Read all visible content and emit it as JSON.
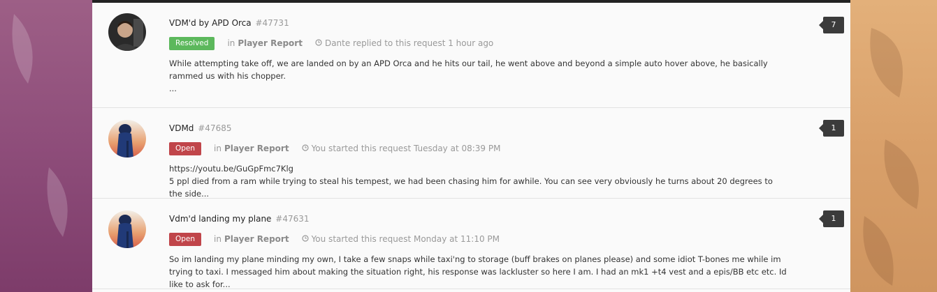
{
  "requests": [
    {
      "title": "VDM'd by APD Orca",
      "id": "#47731",
      "status": "Resolved",
      "in_label": "in",
      "category": "Player Report",
      "activity": "Dante replied to this request 1 hour ago",
      "body": "While attempting take off, we are landed on by an APD Orca and he hits our tail, he went above and beyond a simple auto hover above, he basically rammed us with his chopper.",
      "ellipsis": "...",
      "reply_count": "7"
    },
    {
      "title": "VDMd",
      "id": "#47685",
      "status": "Open",
      "in_label": "in",
      "category": "Player Report",
      "activity": "You started this request Tuesday at 08:39 PM",
      "body_line1": "https://youtu.be/GuGpFmc7Klg",
      "body_line2": "5 ppl died from a ram while trying to steal his tempest, we had been chasing him for awhile. You can see very obviously he turns about 20 degrees to the side...",
      "reply_count": "1"
    },
    {
      "title": "Vdm'd landing my plane",
      "id": "#47631",
      "status": "Open",
      "in_label": "in",
      "category": "Player Report",
      "activity": "You started this request Monday at 11:10 PM",
      "body": "So im landing my plane minding my own, I take a few snaps while taxi'ng to storage (buff brakes on planes please) and some idiot T-bones me while im trying to taxi. I messaged him about making the situation right, his response was lackluster so here I am. I had an mk1 +t4 vest and a epis/BB etc etc. Id like to ask for...",
      "reply_count": "1"
    }
  ]
}
